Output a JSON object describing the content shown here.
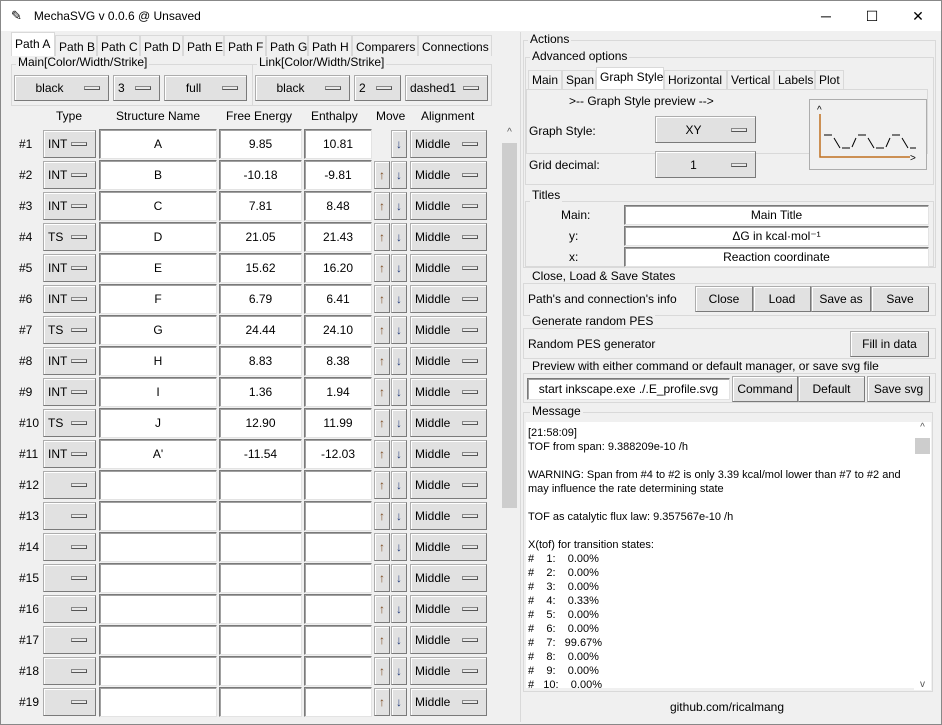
{
  "window": {
    "title": "MechaSVG v 0.0.6 @ Unsaved",
    "minimize": "─",
    "maximize": "☐",
    "close": "✕"
  },
  "path_tabs": [
    "Path A",
    "Path B",
    "Path C",
    "Path D",
    "Path E",
    "Path F",
    "Path G",
    "Path H",
    "Comparers",
    "Connections"
  ],
  "main_style": {
    "label": "Main[Color/Width/Strike]",
    "color": "black",
    "width": "3",
    "strike": "full"
  },
  "link_style": {
    "label": "Link[Color/Width/Strike]",
    "color": "black",
    "width": "2",
    "strike": "dashed1"
  },
  "table_headers": {
    "type": "Type",
    "name": "Structure Name",
    "free_energy": "Free Energy",
    "enthalpy": "Enthalpy",
    "move": "Move",
    "alignment": "Alignment"
  },
  "rows": [
    {
      "num": "#1",
      "type": "INT",
      "name": "A",
      "g": "9.85",
      "h": "10.81",
      "align": "Middle"
    },
    {
      "num": "#2",
      "type": "INT",
      "name": "B",
      "g": "-10.18",
      "h": "-9.81",
      "align": "Middle"
    },
    {
      "num": "#3",
      "type": "INT",
      "name": "C",
      "g": "7.81",
      "h": "8.48",
      "align": "Middle"
    },
    {
      "num": "#4",
      "type": "TS",
      "name": "D",
      "g": "21.05",
      "h": "21.43",
      "align": "Middle"
    },
    {
      "num": "#5",
      "type": "INT",
      "name": "E",
      "g": "15.62",
      "h": "16.20",
      "align": "Middle"
    },
    {
      "num": "#6",
      "type": "INT",
      "name": "F",
      "g": "6.79",
      "h": "6.41",
      "align": "Middle"
    },
    {
      "num": "#7",
      "type": "TS",
      "name": "G",
      "g": "24.44",
      "h": "24.10",
      "align": "Middle"
    },
    {
      "num": "#8",
      "type": "INT",
      "name": "H",
      "g": "8.83",
      "h": "8.38",
      "align": "Middle"
    },
    {
      "num": "#9",
      "type": "INT",
      "name": "I",
      "g": "1.36",
      "h": "1.94",
      "align": "Middle"
    },
    {
      "num": "#10",
      "type": "TS",
      "name": "J",
      "g": "12.90",
      "h": "11.99",
      "align": "Middle"
    },
    {
      "num": "#11",
      "type": "INT",
      "name": "A'",
      "g": "-11.54",
      "h": "-12.03",
      "align": "Middle"
    },
    {
      "num": "#12",
      "type": "",
      "name": "",
      "g": "",
      "h": "",
      "align": "Middle"
    },
    {
      "num": "#13",
      "type": "",
      "name": "",
      "g": "",
      "h": "",
      "align": "Middle"
    },
    {
      "num": "#14",
      "type": "",
      "name": "",
      "g": "",
      "h": "",
      "align": "Middle"
    },
    {
      "num": "#15",
      "type": "",
      "name": "",
      "g": "",
      "h": "",
      "align": "Middle"
    },
    {
      "num": "#16",
      "type": "",
      "name": "",
      "g": "",
      "h": "",
      "align": "Middle"
    },
    {
      "num": "#17",
      "type": "",
      "name": "",
      "g": "",
      "h": "",
      "align": "Middle"
    },
    {
      "num": "#18",
      "type": "",
      "name": "",
      "g": "",
      "h": "",
      "align": "Middle"
    },
    {
      "num": "#19",
      "type": "",
      "name": "",
      "g": "",
      "h": "",
      "align": "Middle"
    }
  ],
  "move_glyphs": {
    "up": "↑",
    "down": "↓"
  },
  "actions": {
    "label": "Actions",
    "advanced_label": "Advanced options",
    "tabs": [
      "Main",
      "Span",
      "Graph Style",
      "Horizontal",
      "Vertical",
      "Labels",
      "Plot"
    ],
    "preview_text": ">-- Graph Style preview -->",
    "graph_style_label": "Graph Style:",
    "graph_style": "XY",
    "grid_decimal_label": "Grid decimal:",
    "grid_decimal": "1"
  },
  "titles": {
    "label": "Titles",
    "main_label": "Main:",
    "main": "Main Title",
    "y_label": "y:",
    "y": "ΔG in kcal·mol⁻¹",
    "x_label": "x:",
    "x": "Reaction coordinate"
  },
  "states": {
    "label": "Close, Load & Save States",
    "info": "Path's and connection's info",
    "close": "Close",
    "load": "Load",
    "save_as": "Save as",
    "save": "Save"
  },
  "random": {
    "label": "Generate random PES",
    "info": "Random PES generator",
    "fill": "Fill in data"
  },
  "preview": {
    "label": "Preview with either command or default manager, or save svg file",
    "command_value": "start inkscape.exe ./.E_profile.svg",
    "command": "Command",
    "default": "Default",
    "save_svg": "Save svg"
  },
  "message": {
    "label": "Message",
    "text": "[21:58:09]\nTOF from span: 9.388209e-10 /h\n\nWARNING: Span from #4 to #2 is only 3.39 kcal/mol lower than #7 to #2 and\nmay influence the rate determining state\n\nTOF as catalytic flux law: 9.357567e-10 /h\n\nX(tof) for transition states:\n#    1:    0.00%\n#    2:    0.00%\n#    3:    0.00%\n#    4:    0.33%\n#    5:    0.00%\n#    6:    0.00%\n#    7:   99.67%\n#    8:    0.00%\n#    9:    0.00%\n#   10:    0.00%"
  },
  "footer": "github.com/ricalmang",
  "colors": {
    "preview_axis": "#c07020",
    "background": "#f0f0f0"
  }
}
